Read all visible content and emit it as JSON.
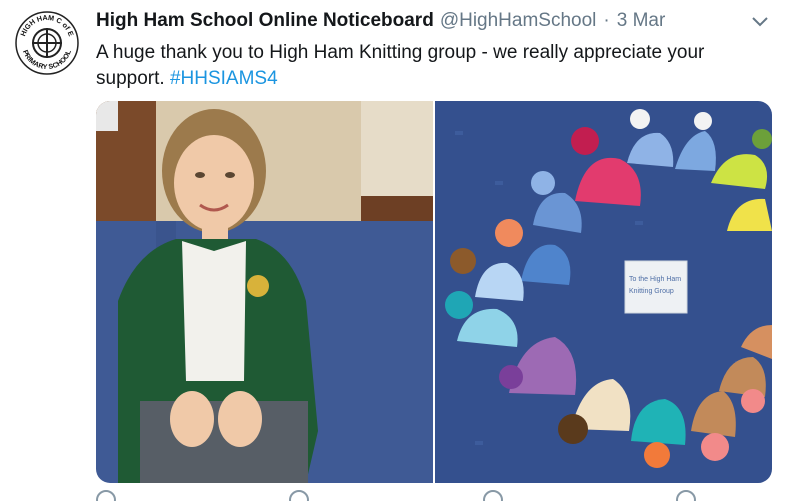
{
  "tweet": {
    "display_name": "High Ham School Online Noticeboard",
    "handle": "@HighHamSchool",
    "separator": "·",
    "timestamp": "3 Mar",
    "text_main": "A huge thank you to High Ham Knitting group - we really appreciate your support.",
    "hashtag": "#HHSIAMS4"
  },
  "avatar": {
    "badge_top": "HIGH HAM C of E",
    "badge_bottom": "PRIMARY SCHOOL"
  },
  "note": {
    "line1": "To the High Ham",
    "line2": "Knitting Group"
  },
  "icons": {
    "menu": "chevron-down-icon",
    "reply": "reply-icon",
    "retweet": "retweet-icon",
    "like": "like-icon",
    "share": "share-icon"
  },
  "colors": {
    "name": "#14171a",
    "secondary": "#657786",
    "link": "#1b95e0",
    "carpet": "#34508e",
    "cardigan": "#1f5a34"
  }
}
